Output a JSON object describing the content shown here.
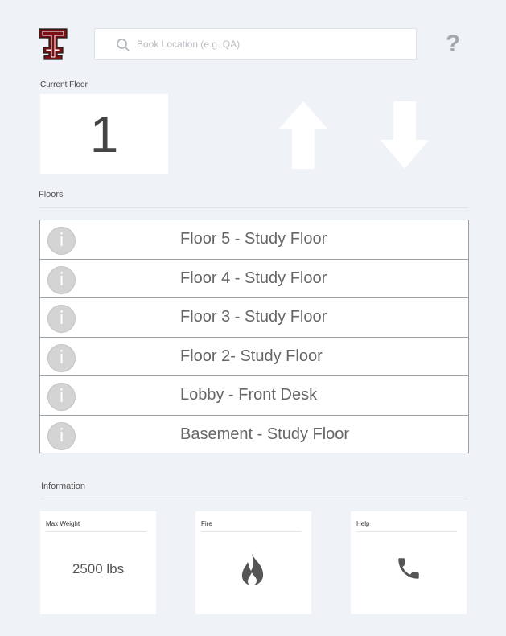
{
  "header": {
    "logo_icon": "texas-tech-double-t-logo",
    "search_placeholder": "Book Location (e.g. QA)",
    "search_value": "",
    "help_label": "?"
  },
  "current_floor": {
    "label": "Current Floor",
    "value": "1"
  },
  "controls": {
    "up_icon": "arrow-up-icon",
    "down_icon": "arrow-down-icon"
  },
  "floors": {
    "label": "Floors",
    "items": [
      {
        "name": "Floor 5 - Study Floor",
        "icon_text": "i"
      },
      {
        "name": "Floor 4 - Study Floor",
        "icon_text": "i"
      },
      {
        "name": "Floor 3 - Study Floor",
        "icon_text": "i"
      },
      {
        "name": "Floor 2- Study Floor",
        "icon_text": "i"
      },
      {
        "name": "Lobby - Front Desk",
        "icon_text": "i"
      },
      {
        "name": "Basement - Study Floor",
        "icon_text": "i"
      }
    ]
  },
  "information": {
    "label": "Information",
    "cards": [
      {
        "title": "Max Weight",
        "value": "2500 lbs"
      },
      {
        "title": "Fire",
        "icon": "fire-icon"
      },
      {
        "title": "Help",
        "icon": "phone-icon"
      }
    ]
  },
  "colors": {
    "background": "#eff2f6",
    "logo_red": "#7a1014",
    "arrow_white": "#ffffff",
    "icon_gray": "#555555"
  }
}
